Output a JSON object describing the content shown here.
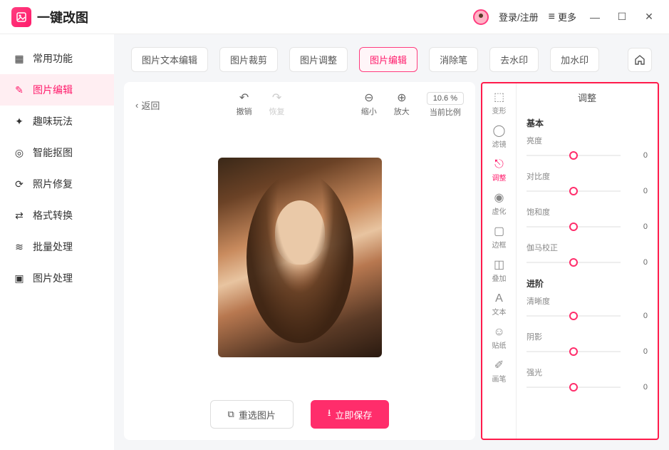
{
  "app": {
    "title": "一键改图",
    "login": "登录/注册",
    "more": "更多"
  },
  "sidebar": {
    "items": [
      {
        "label": "常用功能",
        "icon": "grid"
      },
      {
        "label": "图片编辑",
        "icon": "edit"
      },
      {
        "label": "趣味玩法",
        "icon": "sparkle"
      },
      {
        "label": "智能抠图",
        "icon": "target"
      },
      {
        "label": "照片修复",
        "icon": "repair"
      },
      {
        "label": "格式转换",
        "icon": "convert"
      },
      {
        "label": "批量处理",
        "icon": "stack"
      },
      {
        "label": "图片处理",
        "icon": "image"
      }
    ]
  },
  "tabs": {
    "items": [
      {
        "label": "图片文本编辑"
      },
      {
        "label": "图片裁剪"
      },
      {
        "label": "图片调整"
      },
      {
        "label": "图片编辑"
      },
      {
        "label": "消除笔"
      },
      {
        "label": "去水印"
      },
      {
        "label": "加水印"
      }
    ]
  },
  "toolbar": {
    "back": "返回",
    "undo": "撤销",
    "redo": "恢复",
    "zoom_out": "缩小",
    "zoom_in": "放大",
    "ratio_label": "当前比例",
    "ratio_value": "10.6 %"
  },
  "actions": {
    "reselect": "重选图片",
    "save": "立即保存"
  },
  "tools": {
    "items": [
      {
        "label": "变形"
      },
      {
        "label": "滤镜"
      },
      {
        "label": "调整"
      },
      {
        "label": "虚化"
      },
      {
        "label": "边框"
      },
      {
        "label": "叠加"
      },
      {
        "label": "文本"
      },
      {
        "label": "贴纸"
      },
      {
        "label": "画笔"
      }
    ]
  },
  "adjust": {
    "title": "调整",
    "groups": [
      {
        "title": "基本",
        "sliders": [
          {
            "label": "亮度",
            "value": 0
          },
          {
            "label": "对比度",
            "value": 0
          },
          {
            "label": "饱和度",
            "value": 0
          },
          {
            "label": "伽马校正",
            "value": 0
          }
        ]
      },
      {
        "title": "进阶",
        "sliders": [
          {
            "label": "清晰度",
            "value": 0
          },
          {
            "label": "阴影",
            "value": 0
          },
          {
            "label": "强光",
            "value": 0
          }
        ]
      }
    ]
  }
}
